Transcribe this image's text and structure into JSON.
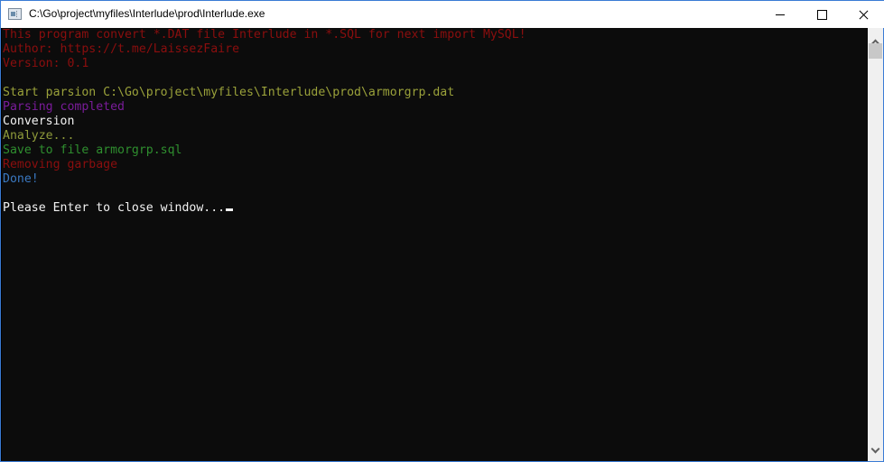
{
  "window": {
    "title": "C:\\Go\\project\\myfiles\\Interlude\\prod\\Interlude.exe",
    "icon": "console-app-icon",
    "controls": {
      "minimize": "minimize-icon",
      "maximize": "maximize-icon",
      "close": "close-icon"
    }
  },
  "console": {
    "lines": [
      {
        "text": "This program convert *.DAT file Interlude in *.SQL for next import MySQL!",
        "color": "#8b0e0e"
      },
      {
        "text": "Author: https://t.me/LaissezFaire",
        "color": "#8b0e0e"
      },
      {
        "text": "Version: 0.1",
        "color": "#8b0e0e"
      },
      {
        "text": "",
        "color": "#cccccc"
      },
      {
        "text": "Start parsion C:\\Go\\project\\myfiles\\Interlude\\prod\\armorgrp.dat",
        "color": "#9aa13a"
      },
      {
        "text": "Parsing completed",
        "color": "#7a1c9a"
      },
      {
        "text": "Conversion",
        "color": "#f2f2f2"
      },
      {
        "text": "Analyze...",
        "color": "#8e9a3a"
      },
      {
        "text": "Save to file armorgrp.sql",
        "color": "#2f8f2f"
      },
      {
        "text": "Removing garbage",
        "color": "#8b0e0e"
      },
      {
        "text": "Done!",
        "color": "#3a78c0"
      },
      {
        "text": "",
        "color": "#cccccc"
      },
      {
        "text": "Please Enter to close window...",
        "color": "#f2f2f2"
      }
    ],
    "cursor_after_line": 12
  },
  "scrollbar": {
    "up_icon": "scroll-up-arrow-icon",
    "down_icon": "scroll-down-arrow-icon"
  }
}
